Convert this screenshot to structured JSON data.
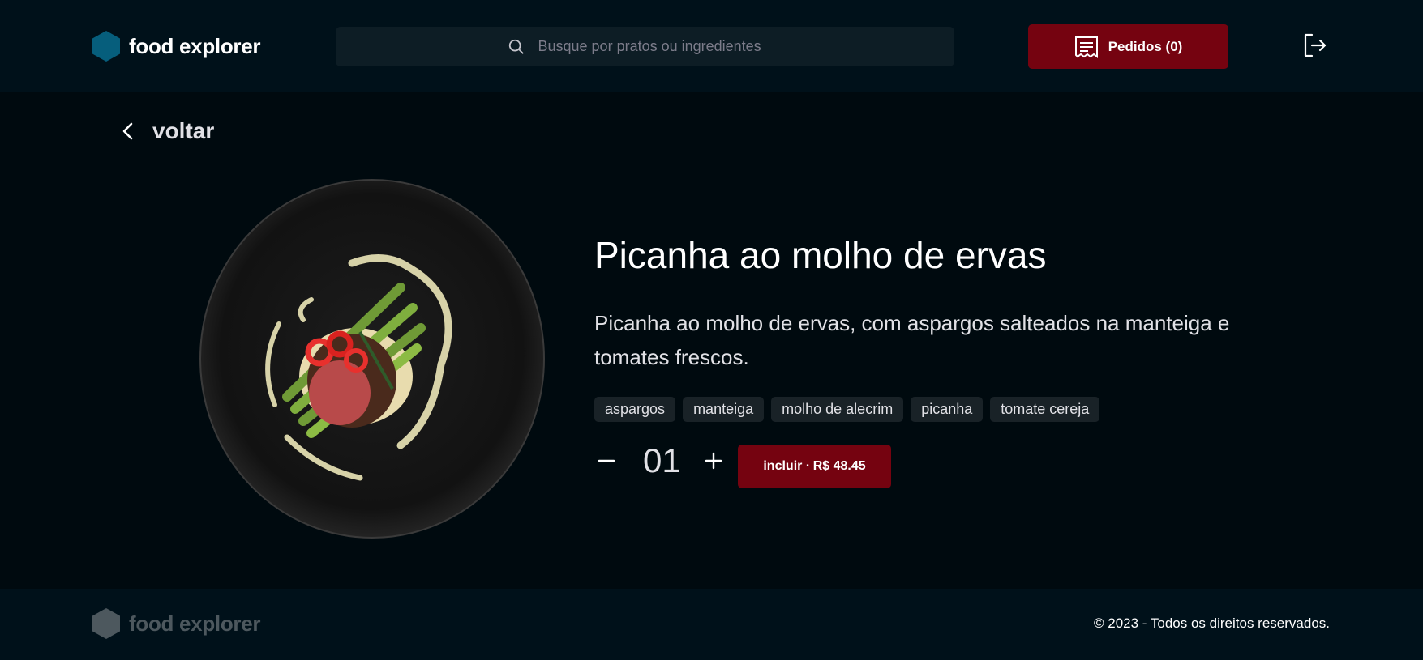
{
  "header": {
    "brand": "food explorer",
    "brand_color": "#065E7C",
    "search_placeholder": "Busque por pratos ou ingredientes",
    "orders_label": "Pedidos (0)",
    "accent_color": "#750310"
  },
  "nav": {
    "back_label": "voltar"
  },
  "dish": {
    "title": "Picanha ao molho de ervas",
    "description": "Picanha ao molho de ervas, com aspargos salteados na manteiga e tomates frescos.",
    "tags": [
      "aspargos",
      "manteiga",
      "molho de alecrim",
      "picanha",
      "tomate cereja"
    ],
    "quantity": "01",
    "include_label": "incluir ∙ R$ 48.45"
  },
  "footer": {
    "brand": "food explorer",
    "brand_color": "#4D585E",
    "copyright": "© 2023 - Todos os direitos reservados."
  }
}
